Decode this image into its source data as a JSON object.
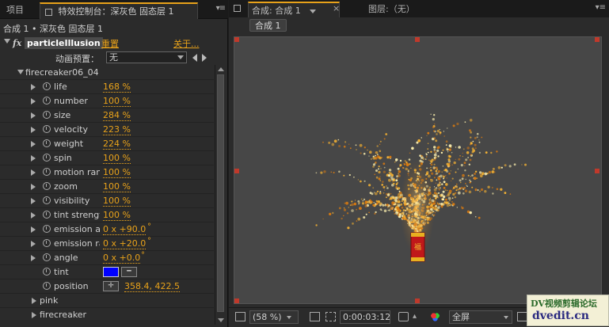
{
  "left_panel": {
    "tabs": {
      "project": "项目",
      "effect_controls": "特效控制台：深灰色 固态层 1",
      "close_glyph": "×",
      "menu_glyph": "▾≡"
    },
    "breadcrumb": "合成 1 • 深灰色 固态层 1",
    "effect": {
      "fx_label": "fx",
      "name": "particleIllusion",
      "reset": "重置",
      "about": "关于..."
    },
    "preset": {
      "label": "动画预置：",
      "value": "无"
    },
    "group_name": "firecreaker06_04",
    "properties": [
      {
        "name": "life",
        "value": "168 %"
      },
      {
        "name": "number",
        "value": "100 %"
      },
      {
        "name": "size",
        "value": "284 %"
      },
      {
        "name": "velocity",
        "value": "223 %"
      },
      {
        "name": "weight",
        "value": "224 %"
      },
      {
        "name": "spin",
        "value": "100 %"
      },
      {
        "name": "motion ran",
        "value": "100 %"
      },
      {
        "name": "zoom",
        "value": "100 %"
      },
      {
        "name": "visibility",
        "value": "100 %"
      },
      {
        "name": "tint strengt",
        "value": "100 %"
      },
      {
        "name": "emission a",
        "value": "0 x +90.0",
        "unit": "°"
      },
      {
        "name": "emission ra",
        "value": "0 x +20.0",
        "unit": "°"
      },
      {
        "name": "angle",
        "value": "0 x +0.0",
        "unit": "°"
      }
    ],
    "tint": {
      "name": "tint",
      "color": "#0000ff"
    },
    "position": {
      "name": "position",
      "value": "358.4, 422.5"
    },
    "sub_groups": [
      "pink",
      "firecreaker"
    ]
  },
  "right_panel": {
    "tabs": {
      "composition": "合成: 合成 1",
      "close_glyph": "×",
      "layer": "图层:（无）",
      "menu_glyph": "▾≡"
    },
    "comp_tab": "合成 1",
    "bottom_bar": {
      "zoom": "(58 %)",
      "timecode": "0:00:03:12",
      "resolution": "全屏"
    },
    "watermark": {
      "line1": "DV视频剪辑论坛",
      "line2": "dvedit.cn"
    }
  },
  "colors": {
    "accent": "#e8a21a",
    "tint_swatch": "#0000ff",
    "handles": "#c0392b",
    "viewer_bg": "#474747"
  }
}
